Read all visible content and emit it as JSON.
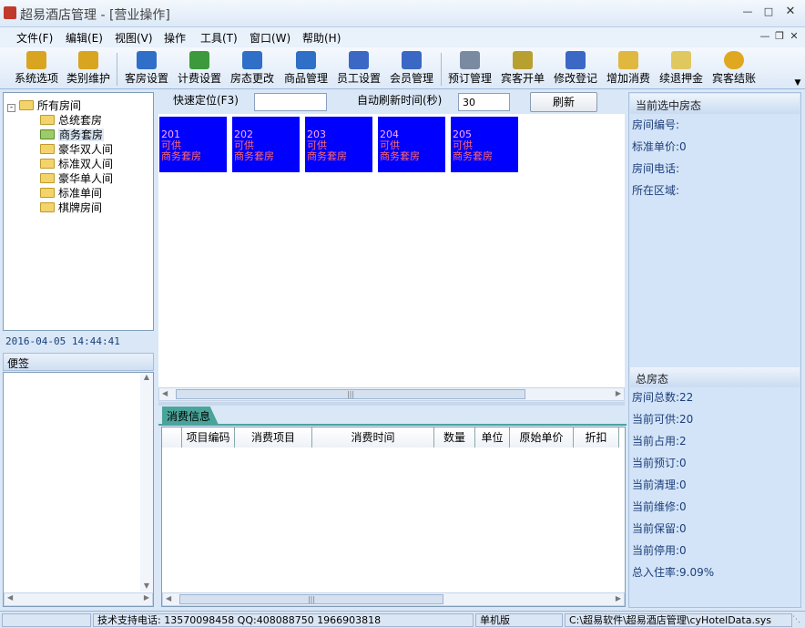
{
  "window": {
    "title": "超易酒店管理 - [营业操作]"
  },
  "menu": [
    "文件(F)",
    "编辑(E)",
    "视图(V)",
    "操作",
    "工具(T)",
    "窗口(W)",
    "帮助(H)"
  ],
  "toolbar": [
    {
      "label": "系统选项",
      "icon": "key-icon"
    },
    {
      "label": "类别维护",
      "icon": "key-icon"
    },
    {
      "label": "客房设置",
      "icon": "bed-icon"
    },
    {
      "label": "计费设置",
      "icon": "calculator-icon"
    },
    {
      "label": "房态更改",
      "icon": "bed-icon"
    },
    {
      "label": "商品管理",
      "icon": "bed-icon"
    },
    {
      "label": "员工设置",
      "icon": "user-icon"
    },
    {
      "label": "会员管理",
      "icon": "user-icon"
    },
    {
      "label": "预订管理",
      "icon": "phone-icon"
    },
    {
      "label": "宾客开单",
      "icon": "box-icon"
    },
    {
      "label": "修改登记",
      "icon": "edit-user-icon"
    },
    {
      "label": "增加消费",
      "icon": "add-note-icon"
    },
    {
      "label": "续退押金",
      "icon": "add-note-icon"
    },
    {
      "label": "宾客结账",
      "icon": "coin-icon"
    }
  ],
  "tree": {
    "root": "所有房间",
    "items": [
      "总统套房",
      "商务套房",
      "豪华双人间",
      "标准双人间",
      "豪华单人间",
      "标准单间",
      "棋牌房间"
    ]
  },
  "datetime": "2016-04-05 14:44:41",
  "notes_label": "便签",
  "quick_locate_label": "快速定位(F3)",
  "refresh_time_label": "自动刷新时间(秒)",
  "refresh_time_value": "30",
  "refresh_button": "刷新",
  "rooms": [
    {
      "number": "201",
      "status": "可供",
      "type": "商务套房"
    },
    {
      "number": "202",
      "status": "可供",
      "type": "商务套房"
    },
    {
      "number": "203",
      "status": "可供",
      "type": "商务套房"
    },
    {
      "number": "204",
      "status": "可供",
      "type": "商务套房"
    },
    {
      "number": "205",
      "status": "可供",
      "type": "商务套房"
    }
  ],
  "consume_tab": "消费信息",
  "consume_columns": [
    "项目编码",
    "消费项目",
    "消费时间",
    "数量",
    "单位",
    "原始单价",
    "折扣"
  ],
  "current_room": {
    "title": "当前选中房态",
    "labels": [
      "房间编号:",
      "标准单价:0",
      "房间电话:",
      "所在区域:"
    ]
  },
  "summary": {
    "title": "总房态",
    "lines": [
      "房间总数:22",
      "当前可供:20",
      "当前占用:2",
      "当前预订:0",
      "当前清理:0",
      "当前维修:0",
      "当前保留:0",
      "当前停用:0",
      "总入住率:9.09%"
    ]
  },
  "status": {
    "support": "技术支持电话: 13570098458 QQ:408088750 1966903818",
    "edition": "单机版",
    "path": "C:\\超易软件\\超易酒店管理\\cyHotelData.sys"
  },
  "colors": {
    "room_bg": "#0000ff",
    "room_number": "#ffaaff",
    "room_text": "#ff6a6a"
  }
}
